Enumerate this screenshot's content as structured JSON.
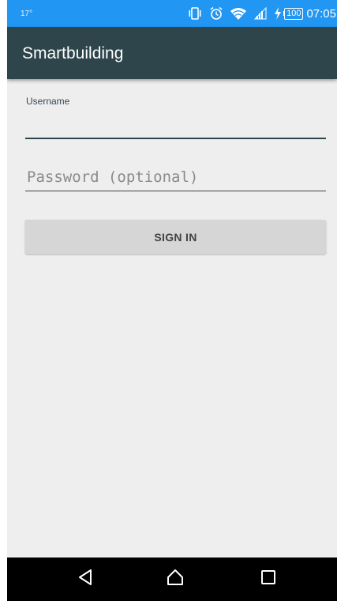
{
  "status_bar": {
    "temperature": "17°",
    "battery_level": "100",
    "time": "07:05",
    "icons": [
      "vibrate-icon",
      "alarm-icon",
      "wifi-icon",
      "signal-icon",
      "charging-icon",
      "battery-icon"
    ]
  },
  "app_bar": {
    "title": "Smartbuilding"
  },
  "form": {
    "username_label": "Username",
    "username_value": "",
    "password_placeholder": "Password (optional)",
    "password_value": "",
    "sign_in_label": "SIGN IN"
  },
  "nav_bar": {
    "icons": [
      "back-icon",
      "home-icon",
      "recents-icon"
    ]
  },
  "colors": {
    "status_bar": "#2196f3",
    "app_bar": "#2e454c",
    "background": "#eeeeee",
    "button": "#d6d6d6",
    "nav_bar": "#000000"
  }
}
